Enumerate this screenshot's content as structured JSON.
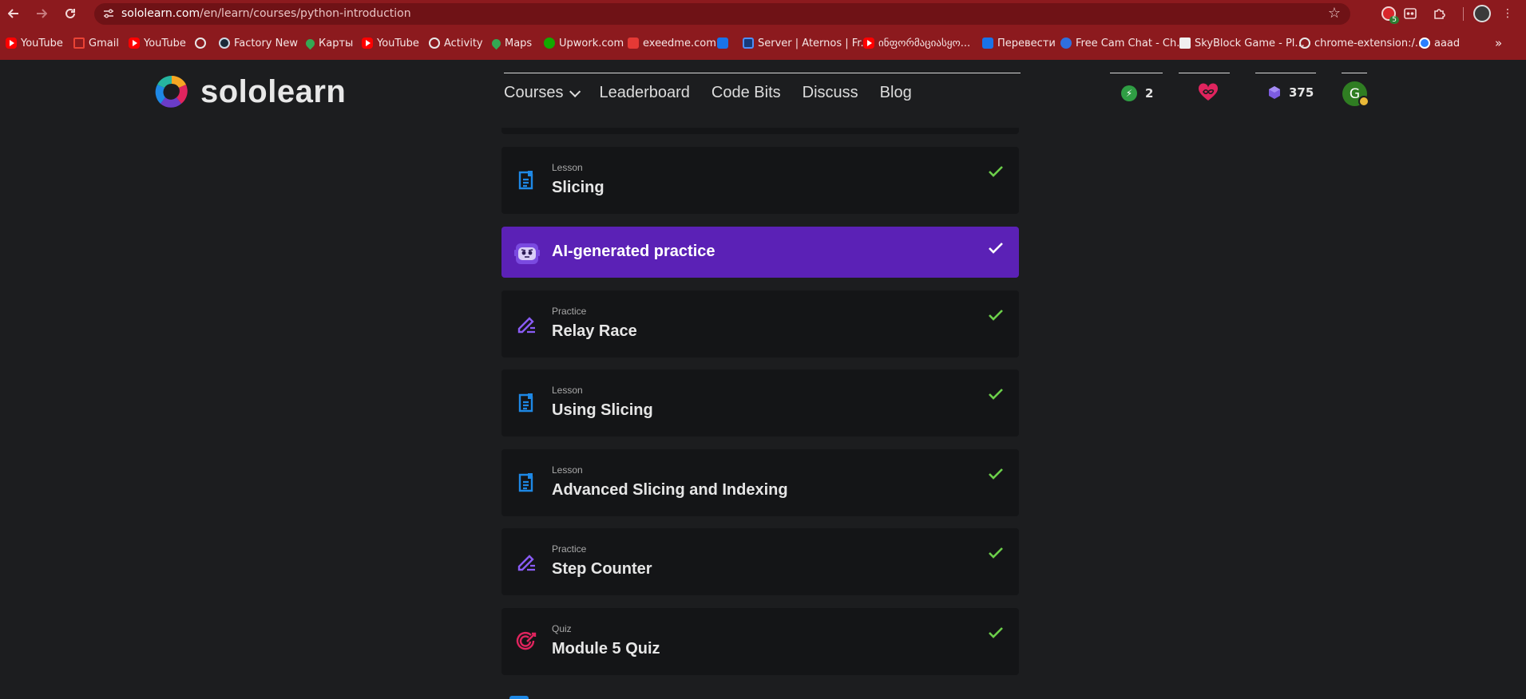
{
  "browser": {
    "url_host": "sololearn.com",
    "url_path": "/en/learn/courses/python-introduction",
    "extension_badge_count": "5",
    "bookmarks": [
      {
        "label": "YouTube",
        "icon": "youtube-icon"
      },
      {
        "label": "Gmail",
        "icon": "gmail-icon"
      },
      {
        "label": "YouTube",
        "icon": "youtube-icon"
      },
      {
        "label": "",
        "icon": "globe-icon"
      },
      {
        "label": "Factory New",
        "icon": "steam-icon"
      },
      {
        "label": "Карты",
        "icon": "maps-icon"
      },
      {
        "label": "YouTube",
        "icon": "youtube-icon"
      },
      {
        "label": "Activity",
        "icon": "globe-icon"
      },
      {
        "label": "Maps",
        "icon": "maps-icon"
      },
      {
        "label": "Upwork.com",
        "icon": "upwork-icon"
      },
      {
        "label": "exeedme.com",
        "icon": "exeedme-icon"
      },
      {
        "label": "",
        "icon": "refresh-app-icon"
      },
      {
        "label": "Server | Aternos | Fr...",
        "icon": "aternos-icon"
      },
      {
        "label": "ინფორმაციასყო...",
        "icon": "youtube-icon"
      },
      {
        "label": "Перевести",
        "icon": "translate-icon"
      },
      {
        "label": "Free Cam Chat - Ch...",
        "icon": "camchat-icon"
      },
      {
        "label": "SkyBlock Game - Pl...",
        "icon": "skyblock-icon"
      },
      {
        "label": "chrome-extension:/...",
        "icon": "globe-icon"
      },
      {
        "label": "aaad",
        "icon": "aaad-icon"
      }
    ]
  },
  "header": {
    "logo_text": "sololearn",
    "nav": [
      "Courses",
      "Leaderboard",
      "Code Bits",
      "Discuss",
      "Blog"
    ],
    "streak": "2",
    "hearts": "∞",
    "gems": "375",
    "avatar_initial": "G"
  },
  "colors": {
    "accent_purple": "#5b21b6",
    "check_green": "#6ccf4a",
    "lesson_blue": "#1e88e5",
    "practice_purple": "#8a5cf6",
    "quiz_pink": "#e0245e"
  },
  "items": [
    {
      "kind": "Lesson",
      "title": "Slicing",
      "icon": "lesson-doc-icon",
      "completed": true
    },
    {
      "kind": "",
      "title": "AI-generated practice",
      "icon": "ai-robot-icon",
      "completed": true,
      "highlight": true
    },
    {
      "kind": "Practice",
      "title": "Relay Race",
      "icon": "practice-pencil-icon",
      "completed": true
    },
    {
      "kind": "Lesson",
      "title": "Using Slicing",
      "icon": "lesson-doc-icon",
      "completed": true
    },
    {
      "kind": "Lesson",
      "title": "Advanced Slicing and Indexing",
      "icon": "lesson-doc-icon",
      "completed": true
    },
    {
      "kind": "Practice",
      "title": "Step Counter",
      "icon": "practice-pencil-icon",
      "completed": true
    },
    {
      "kind": "Quiz",
      "title": "Module 5 Quiz",
      "icon": "quiz-target-icon",
      "completed": true
    }
  ]
}
